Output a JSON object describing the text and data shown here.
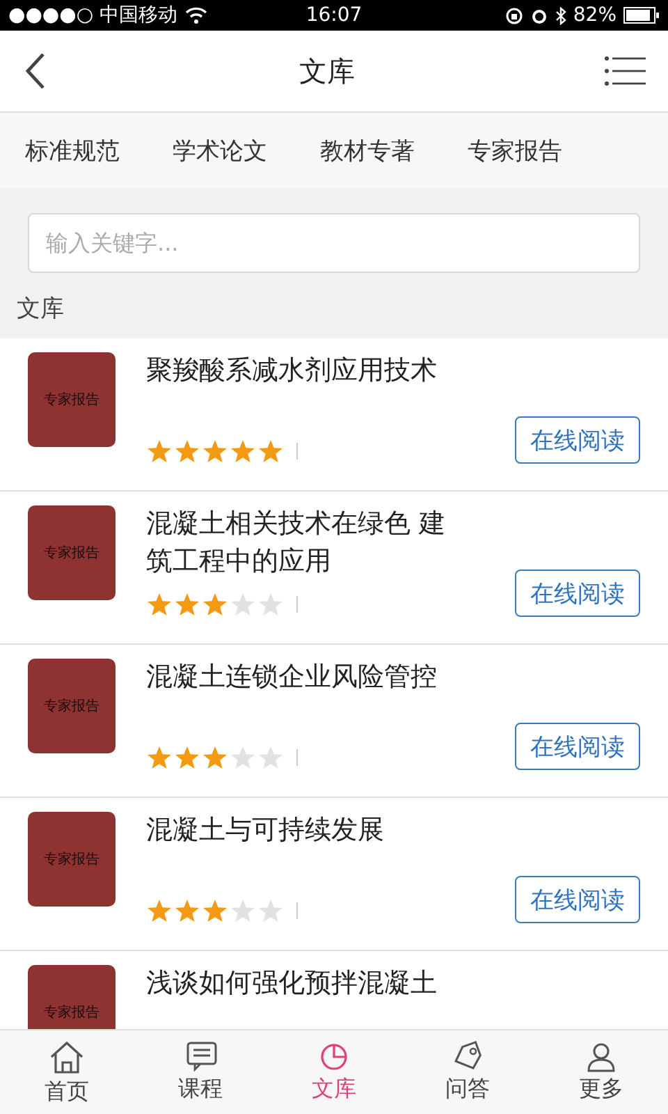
{
  "status_bar": {
    "carrier": "●●●●○ 中国移动",
    "time": "16:07",
    "battery": "82%"
  },
  "nav": {
    "title": "文库"
  },
  "categories": [
    {
      "label": "标准规范",
      "selected": false
    },
    {
      "label": "学术论文",
      "selected": false
    },
    {
      "label": "教材专著",
      "selected": false
    },
    {
      "label": "专家报告",
      "selected": false
    }
  ],
  "search": {
    "placeholder": "输入关键字..."
  },
  "section_title": "文库",
  "documents": [
    {
      "cover": "专家报告",
      "title": "聚羧酸系减水剂应用技术",
      "stars": 5,
      "button": "在线阅读"
    },
    {
      "cover": "专家报告",
      "title": "混凝土相关技术在绿色 建筑工程中的应用",
      "stars": 3,
      "button": "在线阅读"
    },
    {
      "cover": "专家报告",
      "title": "混凝土连锁企业风险管控",
      "stars": 3,
      "button": "在线阅读"
    },
    {
      "cover": "专家报告",
      "title": "混凝土与可持续发展",
      "stars": 3,
      "button": "在线阅读"
    },
    {
      "cover": "专家报告",
      "title": "浅谈如何强化预拌混凝土"
    }
  ],
  "tab_bar": [
    {
      "label": "首页",
      "selected": false
    },
    {
      "label": "课程",
      "selected": false
    },
    {
      "label": "文库",
      "selected": true
    },
    {
      "label": "问答",
      "selected": false
    },
    {
      "label": "更多",
      "selected": false
    }
  ]
}
